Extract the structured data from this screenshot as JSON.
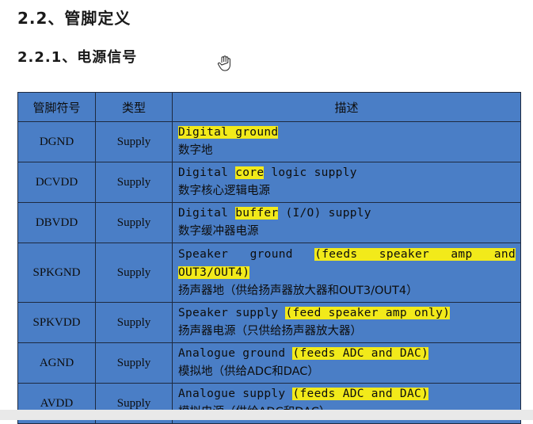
{
  "heading": "2.2、管脚定义",
  "subheading": "2.2.1、电源信号",
  "table": {
    "headers": [
      "管脚符号",
      "类型",
      "描述"
    ],
    "rows": [
      {
        "pin": "DGND",
        "type": "Supply",
        "en_plain_before": "",
        "en_highlight": "Digital ground",
        "en_plain_after": "",
        "zh": "数字地"
      },
      {
        "pin": "DCVDD",
        "type": "Supply",
        "en_plain_before": "Digital ",
        "en_highlight": "core",
        "en_plain_after": " logic supply",
        "zh": "数字核心逻辑电源"
      },
      {
        "pin": "DBVDD",
        "type": "Supply",
        "en_plain_before": "Digital ",
        "en_highlight": "buffer",
        "en_plain_after": " (I/O) supply",
        "zh": "数字缓冲器电源"
      },
      {
        "pin": "SPKGND",
        "type": "Supply",
        "en_plain_before": "Speaker ground ",
        "en_highlight": "(feeds speaker amp and",
        "en_highlight_line2": "OUT3/OUT4)",
        "zh": "扬声器地（供给扬声器放大器和OUT3/OUT4）"
      },
      {
        "pin": "SPKVDD",
        "type": "Supply",
        "en_plain_before": "Speaker supply ",
        "en_highlight": "(feed speaker amp only)",
        "en_plain_after": "",
        "zh": "扬声器电源（只供给扬声器放大器）"
      },
      {
        "pin": "AGND",
        "type": "Supply",
        "en_plain_before": "Analogue ground ",
        "en_highlight": "(feeds ADC and DAC)",
        "en_plain_after": "",
        "zh": "模拟地（供给ADC和DAC）"
      },
      {
        "pin": "AVDD",
        "type": "Supply",
        "en_plain_before": "Analogue supply ",
        "en_highlight": "(feeds ADC and DAC)",
        "en_plain_after": "",
        "zh": "模拟电源（供给ADC和DAC）"
      }
    ]
  },
  "colors": {
    "table_bg": "#4a7ec6",
    "highlight": "#f2ea1a",
    "border": "#1e2a40"
  },
  "icons": {
    "cursor": "hand-cursor-icon"
  }
}
